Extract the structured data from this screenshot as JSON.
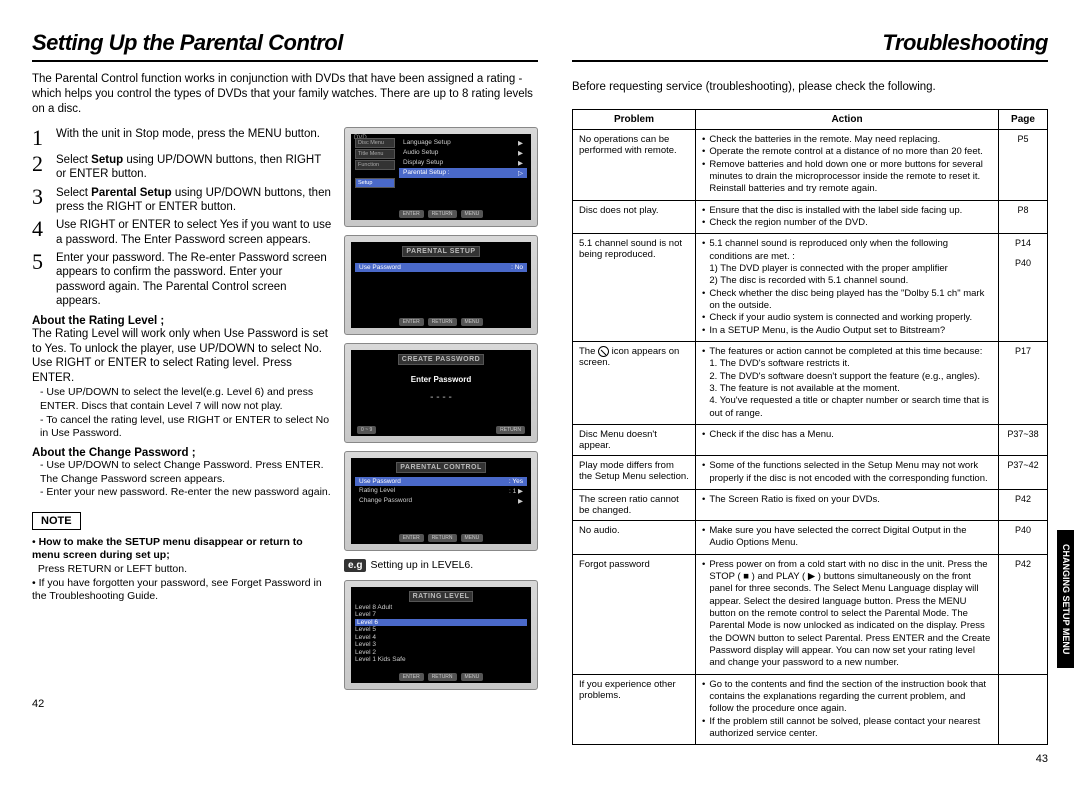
{
  "left": {
    "title": "Setting Up the Parental Control",
    "intro": "The Parental Control function works in conjunction with DVDs that have been assigned a rating - which helps you control the types of DVDs that your family watches. There are up to 8 rating levels on a disc.",
    "steps": [
      "With the unit in Stop mode, press the MENU button.",
      "Select Setup using UP/DOWN buttons, then RIGHT or ENTER button.",
      "Select Parental Setup using UP/DOWN buttons, then press the RIGHT or ENTER button.",
      "Use RIGHT or ENTER to select Yes if you want to use a password. The Enter Password screen appears.",
      "Enter your password. The Re-enter Password screen appears to confirm the password. Enter your password again. The Parental Control screen appears."
    ],
    "rating_head": "About the Rating Level ;",
    "rating_text": "The Rating Level will work only when Use Password is set to Yes. To unlock the player, use UP/DOWN to select No. Use RIGHT or ENTER to select Rating level. Press ENTER.",
    "rating_sub": [
      "Use UP/DOWN to select the level(e.g. Level 6) and press ENTER. Discs that contain Level 7 will now not play.",
      "To cancel the rating level, use RIGHT or ENTER to select No in Use Password."
    ],
    "change_head": "About the Change Password ;",
    "change_sub": [
      "Use UP/DOWN to select Change Password. Press ENTER. The Change Password screen appears.",
      "Enter your new password. Re-enter the new password again."
    ],
    "eg_label": "e.g",
    "eg_text": "Setting up in LEVEL6.",
    "note_label": "NOTE",
    "note1_bold": "How to make the SETUP menu disappear or return to menu screen during set up;",
    "note1_text": "Press RETURN or LEFT button.",
    "note2": "If you have forgotten your password, see Forget Password in the Troubleshooting Guide.",
    "pagenum": "42",
    "tv1": {
      "dvd": "DVD",
      "side": [
        "Disc Menu",
        "Title Menu",
        "Function",
        "",
        "Setup"
      ],
      "menu": [
        "Language Setup",
        "Audio Setup",
        "Display Setup",
        "Parental Setup :"
      ],
      "foot": [
        "ENTER",
        "RETURN",
        "MENU"
      ]
    },
    "tv2": {
      "title": "PARENTAL SETUP",
      "row_label": "Use Password",
      "row_value": ": No",
      "foot": [
        "ENTER",
        "RETURN",
        "MENU"
      ]
    },
    "tv3": {
      "title": "CREATE PASSWORD",
      "enter": "Enter Password",
      "dots": "- - - -",
      "foot_left": "0 ~ 9",
      "foot_right": "RETURN"
    },
    "tv4": {
      "title": "PARENTAL CONTROL",
      "rows": [
        {
          "k": "Use Password",
          "v": ": Yes"
        },
        {
          "k": "Rating Level",
          "v": ": 1"
        },
        {
          "k": "Change Password",
          "v": ""
        }
      ],
      "foot": [
        "ENTER",
        "RETURN",
        "MENU"
      ]
    },
    "tv5": {
      "title": "RATING LEVEL",
      "levels": [
        "Level 8 Adult",
        "Level 7",
        "Level 6",
        "Level 5",
        "Level 4",
        "Level 3",
        "Level 2",
        "Level 1 Kids Safe"
      ],
      "sel": 2,
      "foot": [
        "ENTER",
        "RETURN",
        "MENU"
      ]
    }
  },
  "right": {
    "title": "Troubleshooting",
    "intro": "Before requesting service (troubleshooting), please check the following.",
    "headers": [
      "Problem",
      "Action",
      "Page"
    ],
    "rows": [
      {
        "problem": "No operations can be performed with remote.",
        "actions": [
          "Check the batteries in the remote. May need replacing.",
          "Operate the remote control at a distance of no more than 20 feet.",
          "Remove batteries and hold down one or more buttons for several minutes to drain the microprocessor inside the remote to reset it. Reinstall batteries and try remote again."
        ],
        "page": "P5"
      },
      {
        "problem": "Disc does not play.",
        "actions": [
          "Ensure that the disc is installed with the label side facing up.",
          "Check the region number of the DVD."
        ],
        "page": "P8"
      },
      {
        "problem": "5.1 channel sound is not being reproduced.",
        "actions": [
          "5.1 channel sound is reproduced only when the following conditions are met. :\n1) The DVD player is connected with the proper amplifier\n2) The disc is recorded with 5.1 channel sound.",
          "Check whether the disc being played has the \"Dolby 5.1 ch\" mark on the outside.",
          "Check if your audio system is connected and working properly.",
          "In a SETUP Menu, is the Audio Output set to Bitstream?"
        ],
        "page": "P14\n\nP40"
      },
      {
        "problem": "The ⊘ icon appears on screen.",
        "actions": [
          "The features or action cannot be completed at this time because:\n1. The DVD's software restricts it.\n2. The DVD's software doesn't support the feature (e.g., angles).\n3. The feature is not available at the moment.\n4. You've requested a title or chapter number or search time that is out of range."
        ],
        "page": "P17"
      },
      {
        "problem": "Disc Menu doesn't appear.",
        "actions": [
          "Check if the disc has a Menu."
        ],
        "page": "P37~38"
      },
      {
        "problem": "Play mode differs from the Setup Menu selection.",
        "actions": [
          "Some of the functions selected in the Setup Menu may not work properly if the disc is not encoded with the corresponding function."
        ],
        "page": "P37~42"
      },
      {
        "problem": "The screen ratio cannot be changed.",
        "actions": [
          "The Screen Ratio is fixed on your DVDs."
        ],
        "page": "P42"
      },
      {
        "problem": "No audio.",
        "actions": [
          "Make sure you have selected the correct Digital Output in the Audio Options Menu."
        ],
        "page": "P40"
      },
      {
        "problem": "Forgot password",
        "actions": [
          "Press power on from a cold start with no disc in the unit. Press the STOP ( ■ ) and PLAY ( ▶ ) buttons simultaneously on the front panel for three seconds. The Select Menu Language display will appear. Select the desired language button. Press the MENU button on the remote control to select the Parental Mode. The Parental Mode is now unlocked as indicated on the display. Press the DOWN button to select Parental. Press ENTER and the Create Password display will appear. You can now set your rating level and change your password to a new number."
        ],
        "page": "P42"
      },
      {
        "problem": "If you experience other problems.",
        "actions": [
          "Go to the contents and find the section of the instruction book that contains the explanations regarding the current problem, and follow the procedure once again.",
          "If the problem still cannot be solved, please contact your nearest authorized service center."
        ],
        "page": ""
      }
    ],
    "side_tab": "CHANGING SETUP MENU",
    "pagenum": "43"
  }
}
